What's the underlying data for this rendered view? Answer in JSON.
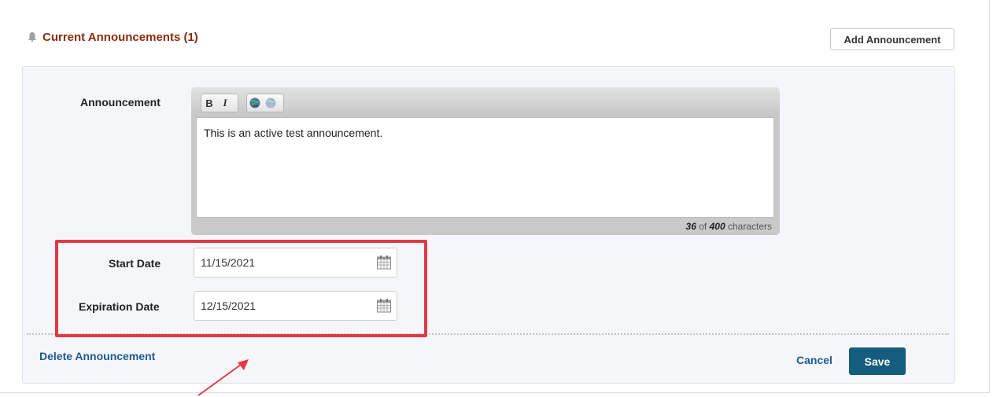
{
  "header": {
    "title": "Current Announcements (1)",
    "add_button": "Add Announcement"
  },
  "form": {
    "announcement_label": "Announcement",
    "toolbar": {
      "bold": "B",
      "italic": "I",
      "icons": [
        "link-icon",
        "unlink-icon"
      ]
    },
    "announcement_text": "This is an active test announcement.",
    "char_count": "36",
    "char_of": "of",
    "char_max": "400",
    "char_suffix": "characters",
    "start_date_label": "Start Date",
    "start_date_value": "11/15/2021",
    "expiration_date_label": "Expiration Date",
    "expiration_date_value": "12/15/2021"
  },
  "footer": {
    "delete_link": "Delete Announcement",
    "cancel_link": "Cancel",
    "save_button": "Save"
  },
  "colors": {
    "title": "#8b2b10",
    "link": "#1e5a8c",
    "save_button": "#155d7e",
    "highlight": "#e03a44"
  }
}
